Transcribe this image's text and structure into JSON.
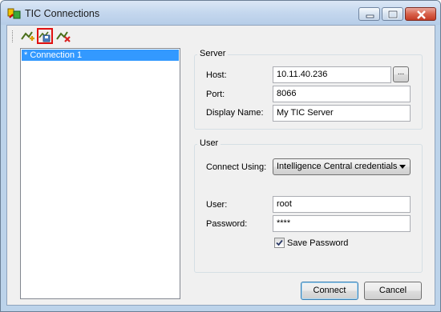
{
  "window": {
    "title": "TIC Connections"
  },
  "toolbar": {
    "buttons": [
      {
        "icon": "add-connection-icon"
      },
      {
        "icon": "save-connection-icon",
        "selected": true
      },
      {
        "icon": "delete-connection-icon"
      }
    ]
  },
  "connections": {
    "items": [
      "* Connection 1"
    ]
  },
  "server": {
    "group_label": "Server",
    "host_label": "Host:",
    "host_value": "10.11.40.236",
    "browse_label": "...",
    "port_label": "Port:",
    "port_value": "8066",
    "display_name_label": "Display Name:",
    "display_name_value": "My TIC Server"
  },
  "user": {
    "group_label": "User",
    "connect_using_label": "Connect Using:",
    "connect_using_value": "Intelligence Central credentials",
    "user_label": "User:",
    "user_value": "root",
    "password_label": "Password:",
    "password_value": "****",
    "save_password_label": "Save Password",
    "save_password_checked": true
  },
  "actions": {
    "connect_label": "Connect",
    "cancel_label": "Cancel"
  },
  "colors": {
    "selection": "#3399ff",
    "toolbar_highlight": "#e01010"
  }
}
